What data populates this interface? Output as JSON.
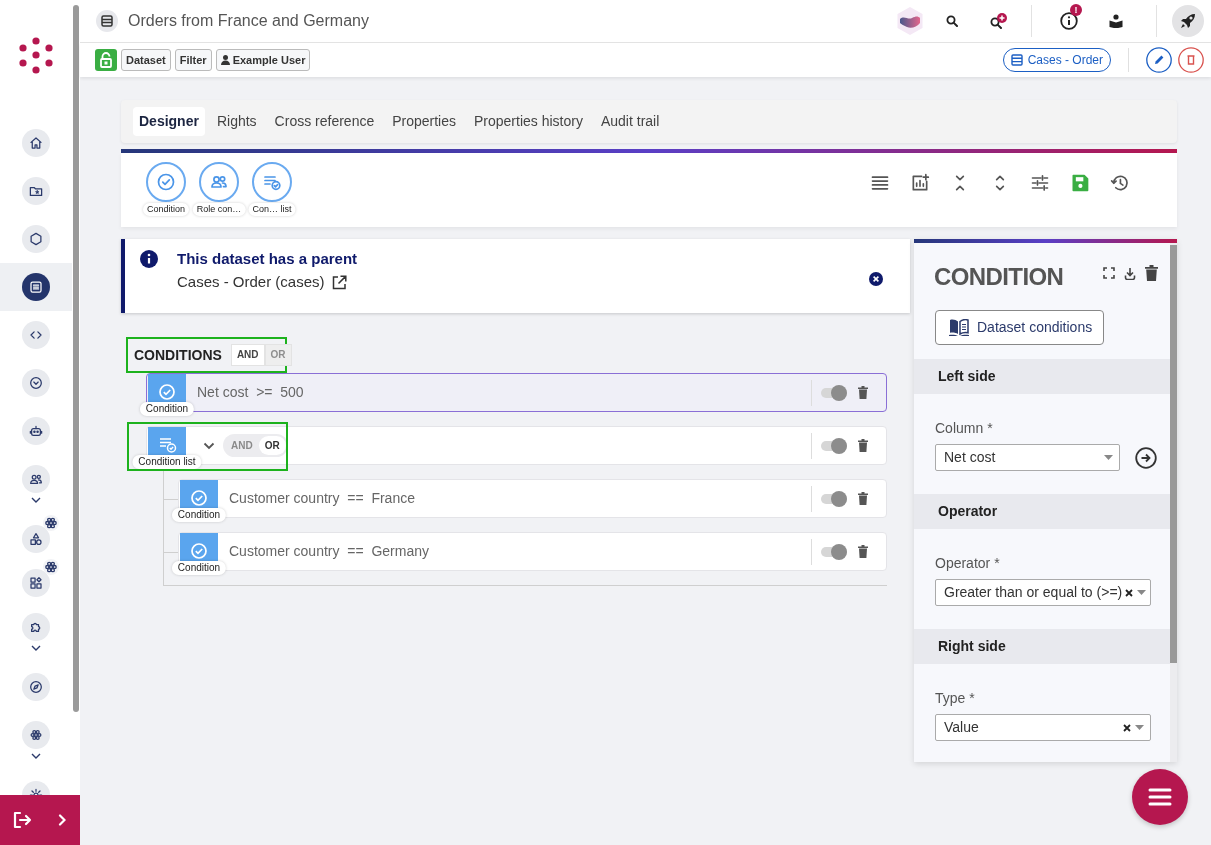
{
  "sidebar": {
    "items": [
      {
        "selected": false,
        "has_submenu": false,
        "has_badge": false
      },
      {
        "selected": false,
        "has_submenu": false,
        "has_badge": false
      },
      {
        "selected": false,
        "has_submenu": false,
        "has_badge": false
      },
      {
        "selected": true,
        "has_submenu": false,
        "has_badge": false
      },
      {
        "selected": false,
        "has_submenu": false,
        "has_badge": false
      },
      {
        "selected": false,
        "has_submenu": false,
        "has_badge": false
      },
      {
        "selected": false,
        "has_submenu": false,
        "has_badge": false
      },
      {
        "selected": false,
        "has_submenu": true,
        "has_badge": false
      },
      {
        "selected": false,
        "has_submenu": false,
        "has_badge": true
      },
      {
        "selected": false,
        "has_submenu": false,
        "has_badge": true
      },
      {
        "selected": false,
        "has_submenu": true,
        "has_badge": false
      },
      {
        "selected": false,
        "has_submenu": false,
        "has_badge": false
      },
      {
        "selected": false,
        "has_submenu": true,
        "has_badge": false
      },
      {
        "selected": false,
        "has_submenu": false,
        "has_badge": false
      }
    ]
  },
  "header": {
    "title": "Orders from France and Germany",
    "notification_badge": "!"
  },
  "context_tags": [
    {
      "kind": "plain",
      "label": "Dataset"
    },
    {
      "kind": "plain",
      "label": "Filter"
    },
    {
      "kind": "user",
      "label": "Example User"
    }
  ],
  "parent_link": "Cases - Order",
  "tabs": [
    {
      "label": "Designer",
      "selected": true
    },
    {
      "label": "Rights",
      "selected": false
    },
    {
      "label": "Cross reference",
      "selected": false
    },
    {
      "label": "Properties",
      "selected": false
    },
    {
      "label": "Properties history",
      "selected": false
    },
    {
      "label": "Audit trail",
      "selected": false
    }
  ],
  "palette": [
    {
      "kind": "condition",
      "label": "Condition"
    },
    {
      "kind": "role",
      "label": "Role con…"
    },
    {
      "kind": "list",
      "label": "Con… list"
    }
  ],
  "alert": {
    "title": "This dataset has a parent",
    "text": "Cases - Order (cases)"
  },
  "conditions": {
    "title": "CONDITIONS",
    "highlighted": true,
    "operators": [
      {
        "label": "AND",
        "selected": true
      },
      {
        "label": "OR",
        "selected": false
      }
    ],
    "items": [
      {
        "kind": "condition",
        "label": "Condition",
        "text": "Net cost  >=  500",
        "selected": true,
        "enabled": true,
        "highlighted": false
      },
      {
        "kind": "list",
        "label": "Condition list",
        "selected": false,
        "enabled": true,
        "highlighted": true,
        "expanded": true,
        "operators": [
          {
            "label": "AND",
            "selected": false
          },
          {
            "label": "OR",
            "selected": true
          }
        ],
        "children": [
          {
            "kind": "condition",
            "label": "Condition",
            "text": "Customer country  ==  France",
            "selected": false,
            "enabled": true,
            "highlighted": false
          },
          {
            "kind": "condition",
            "label": "Condition",
            "text": "Customer country  ==  Germany",
            "selected": false,
            "enabled": true,
            "highlighted": false
          }
        ]
      }
    ]
  },
  "panel": {
    "title": "CONDITION",
    "button": "Dataset conditions",
    "sections": [
      {
        "title": "Left side",
        "field": {
          "label": "Column *",
          "value": "Net cost",
          "clearable": false,
          "has_action": true
        }
      },
      {
        "title": "Operator",
        "field": {
          "label": "Operator *",
          "value": "Greater than or equal to (>=)",
          "clearable": true,
          "has_action": false
        }
      },
      {
        "title": "Right side",
        "field": {
          "label": "Type *",
          "value": "Value",
          "clearable": true,
          "has_action": false
        }
      }
    ]
  }
}
